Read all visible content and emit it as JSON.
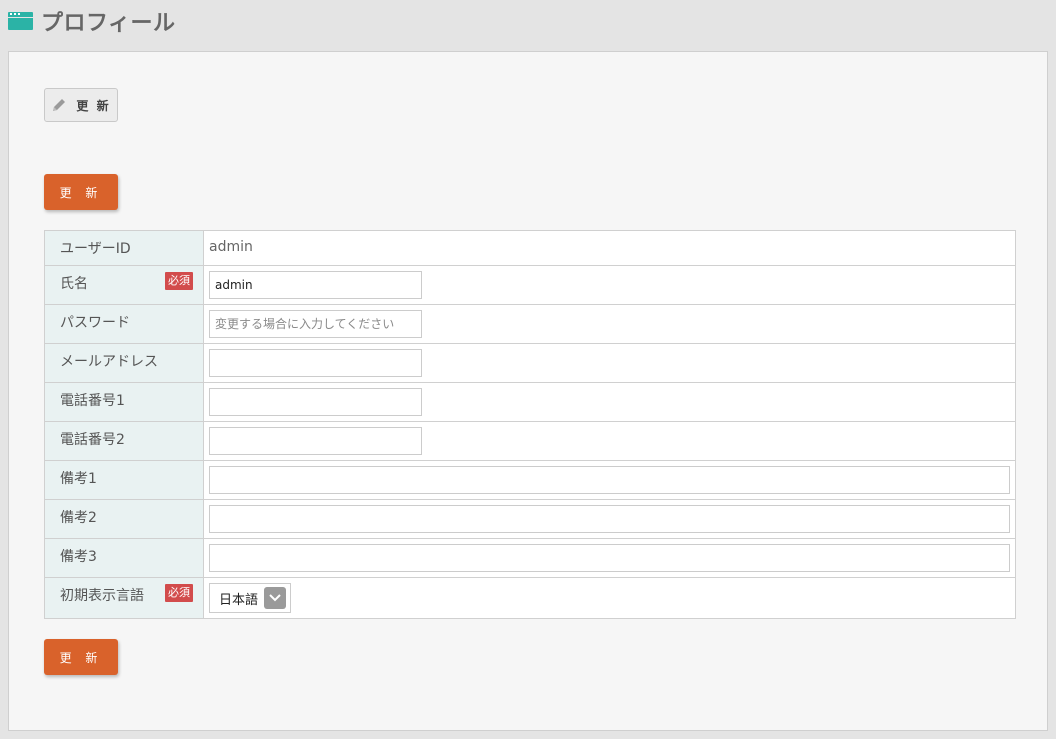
{
  "header": {
    "title": "プロフィール",
    "icon": "window-icon",
    "icon_color": "#2bb3a6"
  },
  "toolbar": {
    "edit_label": "更 新",
    "edit_icon": "pencil-icon"
  },
  "buttons": {
    "update_label": "更 新",
    "update_color": "#d9622b"
  },
  "required_label": "必須",
  "form": {
    "user_id": {
      "label": "ユーザーID",
      "value": "admin"
    },
    "name": {
      "label": "氏名",
      "value": "admin",
      "required": true
    },
    "password": {
      "label": "パスワード",
      "placeholder": "変更する場合に入力してください",
      "value": ""
    },
    "email": {
      "label": "メールアドレス",
      "value": ""
    },
    "phone1": {
      "label": "電話番号1",
      "value": ""
    },
    "phone2": {
      "label": "電話番号2",
      "value": ""
    },
    "note1": {
      "label": "備考1",
      "value": ""
    },
    "note2": {
      "label": "備考2",
      "value": ""
    },
    "note3": {
      "label": "備考3",
      "value": ""
    },
    "language": {
      "label": "初期表示言語",
      "selected": "日本語",
      "required": true
    }
  }
}
